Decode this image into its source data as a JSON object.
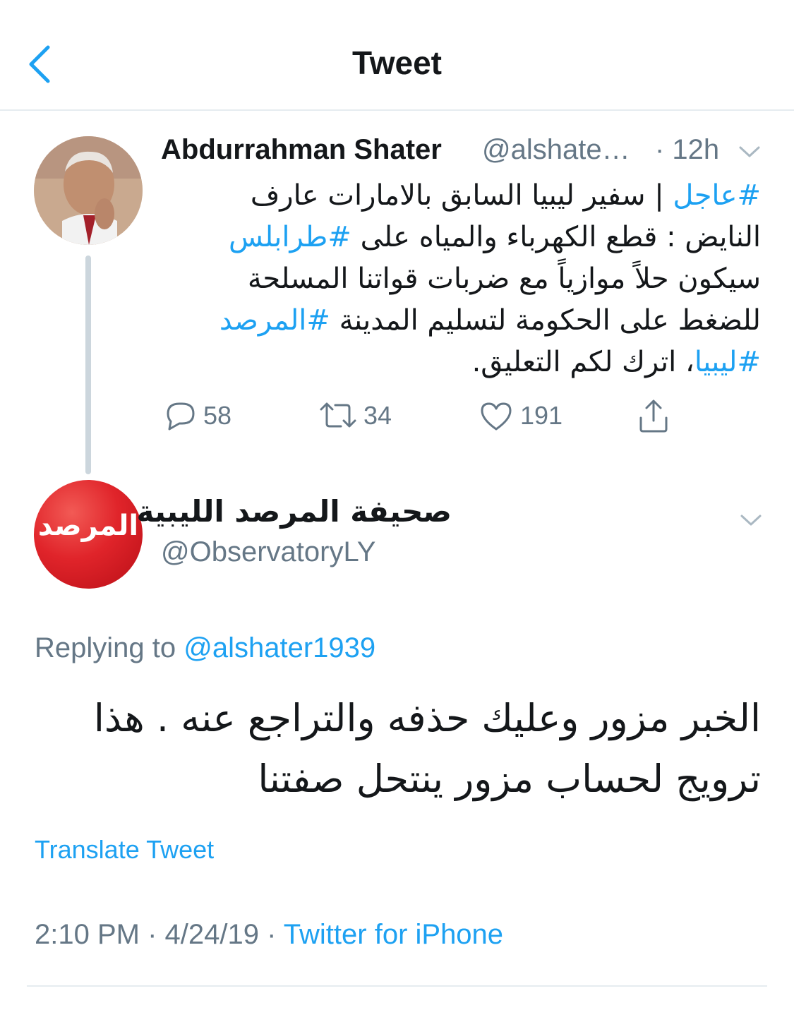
{
  "header": {
    "title": "Tweet"
  },
  "parent_tweet": {
    "author_name": "Abdurrahman Shater",
    "author_handle": "@alshate…",
    "time": "· 12h",
    "body_lines": [
      [
        {
          "text": "#عاجل",
          "tag": true
        },
        {
          "text": " | سفير ليبيا السابق بالامارات عارف",
          "tag": false
        }
      ],
      [
        {
          "text": "النايض : قطع الكهرباء والمياه على ",
          "tag": false
        },
        {
          "text": "#طرابلس",
          "tag": true
        }
      ],
      [
        {
          "text": "سيكون حلاً موازياً مع ضربات قواتنا المسلحة",
          "tag": false
        }
      ],
      [
        {
          "text": " للضغط على الحكومة لتسليم المدينة ",
          "tag": false
        },
        {
          "text": "#المرصد",
          "tag": true
        }
      ],
      [
        {
          "text": "#ليبيا",
          "tag": true
        },
        {
          "text": "، اترك لكم التعليق.",
          "tag": false
        }
      ]
    ],
    "replies": "58",
    "retweets": "34",
    "likes": "191"
  },
  "reply_tweet": {
    "author_name": "صحيفة المرصد الليبية",
    "author_handle": "@ObservatoryLY",
    "avatar_logo_text": "المرصد",
    "replying_prefix": "Replying to ",
    "replying_to": "@alshater1939",
    "body_lines": [
      "الخبر مزور وعليك حذفه والتراجع عنه . هذا",
      "ترويج لحساب مزور ينتحل صفتنا"
    ],
    "translate_label": "Translate Tweet",
    "timestamp": "2:10 PM · 4/24/19 · ",
    "source": "Twitter for iPhone"
  },
  "colors": {
    "accent": "#1da1f2",
    "muted": "#657786",
    "divider": "#e6ecf0",
    "logo_red": "#e0242a"
  }
}
